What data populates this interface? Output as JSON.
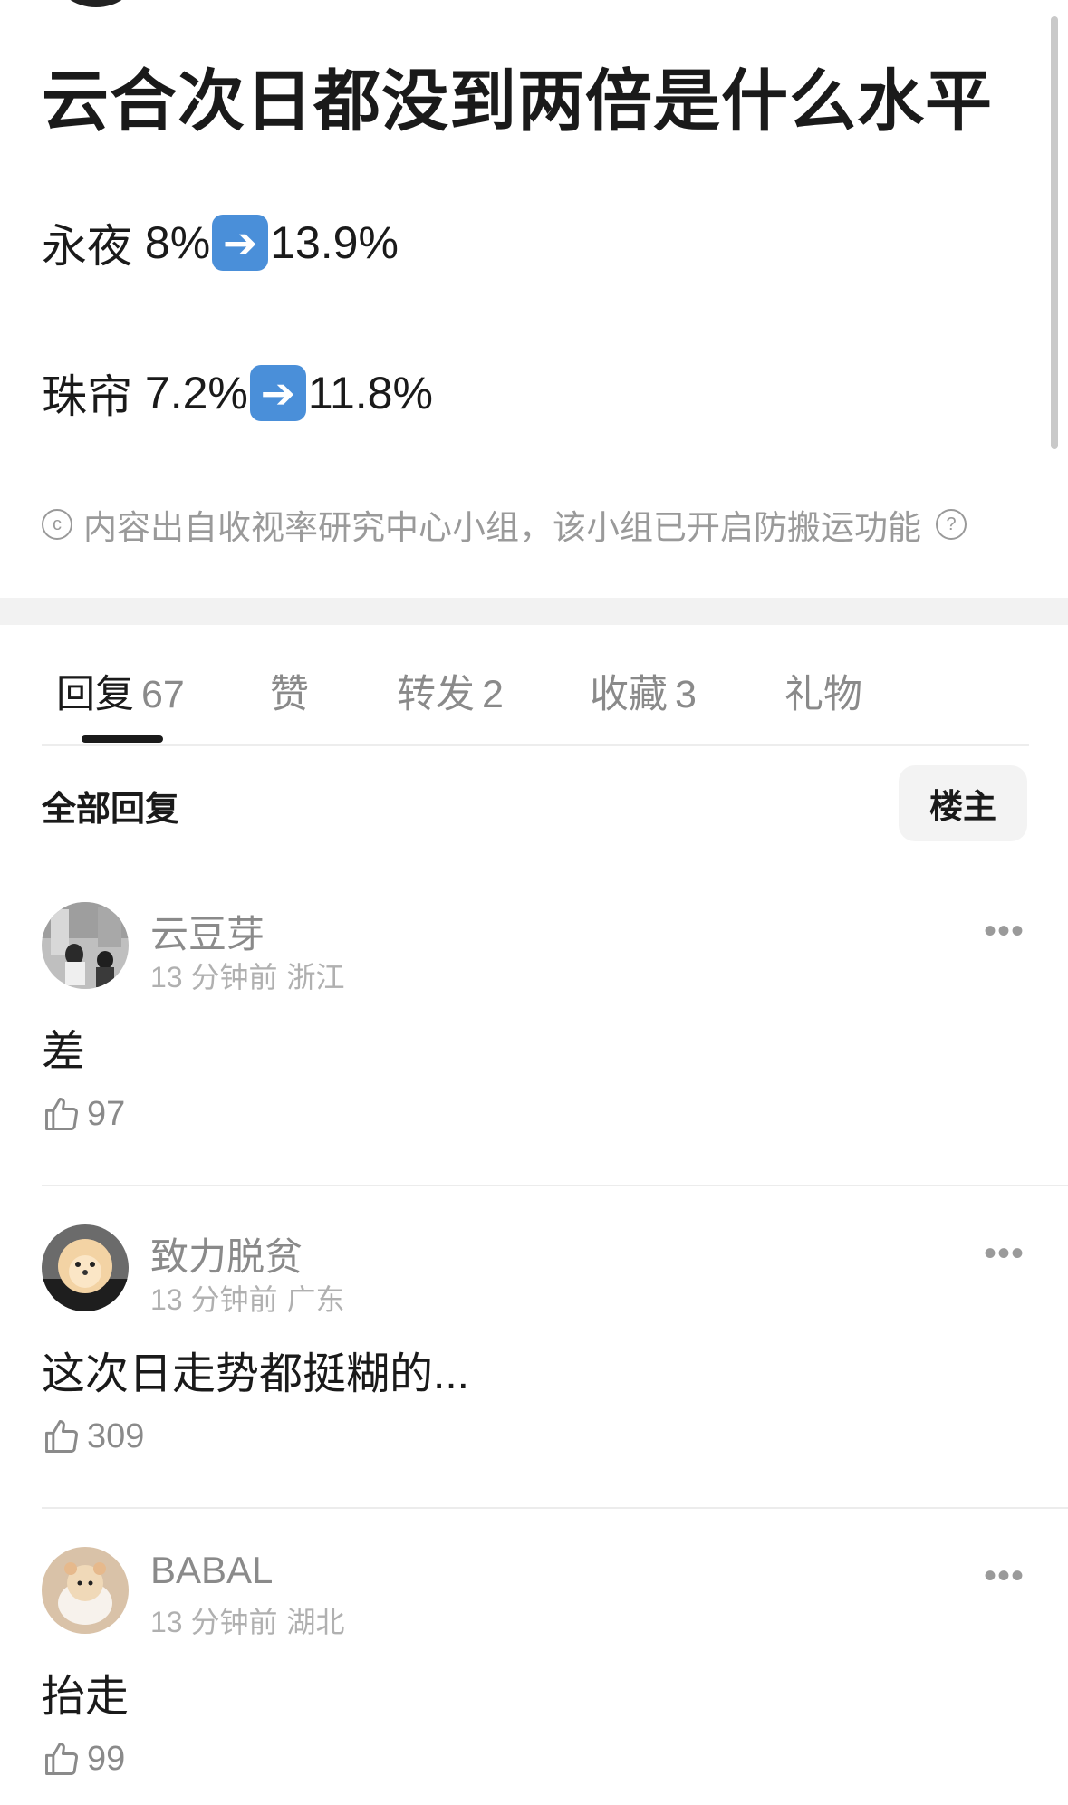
{
  "post": {
    "title": "云合次日都没到两倍是什么水平",
    "lines": [
      {
        "name": "永夜",
        "from": "8%",
        "to": "13.9%"
      },
      {
        "name": "珠帘",
        "from": "7.2%",
        "to": "11.8%"
      }
    ],
    "copyright_symbol": "c",
    "copyright": "内容出自收视率研究中心小组，该小组已开启防搬运功能",
    "help_symbol": "?"
  },
  "tabs": [
    {
      "label": "回复",
      "count": "67",
      "active": true
    },
    {
      "label": "赞",
      "count": "",
      "active": false
    },
    {
      "label": "转发",
      "count": "2",
      "active": false
    },
    {
      "label": "收藏",
      "count": "3",
      "active": false
    },
    {
      "label": "礼物",
      "count": "",
      "active": false
    }
  ],
  "replies_header": {
    "title": "全部回复",
    "op_filter": "楼主"
  },
  "comments": [
    {
      "user": "云豆芽",
      "time": "13 分钟前",
      "location": "浙江",
      "text": "差",
      "likes": "97",
      "avatar_color": "#8c8c8c"
    },
    {
      "user": "致力脱贫",
      "time": "13 分钟前",
      "location": "广东",
      "text": "这次日走势都挺糊的...",
      "likes": "309",
      "avatar_color": "#d9a36b"
    },
    {
      "user": "BABAL",
      "time": "13 分钟前",
      "location": "湖北",
      "text": "抬走",
      "likes": "99",
      "avatar_color": "#e6c8a8"
    }
  ],
  "icons": {
    "arrow": "right-arrow-icon",
    "more": "more-dots-icon",
    "like": "thumbs-up-icon"
  },
  "more_glyph": "•••"
}
